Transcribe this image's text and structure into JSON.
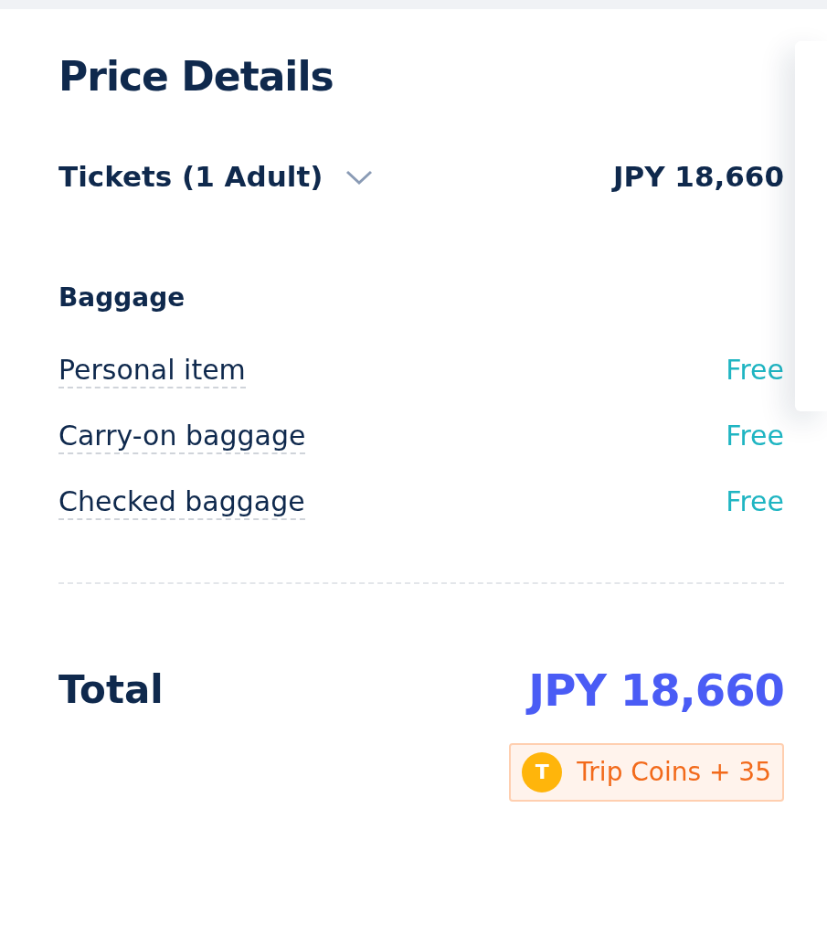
{
  "title": "Price Details",
  "tickets": {
    "label": "Tickets (1 Adult)",
    "expanded": false,
    "price": "JPY 18,660"
  },
  "baggage": {
    "heading": "Baggage",
    "items": [
      {
        "name": "Personal item",
        "price": "Free"
      },
      {
        "name": "Carry-on baggage",
        "price": "Free"
      },
      {
        "name": "Checked baggage",
        "price": "Free"
      }
    ]
  },
  "total": {
    "label": "Total",
    "price": "JPY 18,660"
  },
  "reward": {
    "coin_symbol": "T",
    "text": "Trip Coins + 35"
  }
}
